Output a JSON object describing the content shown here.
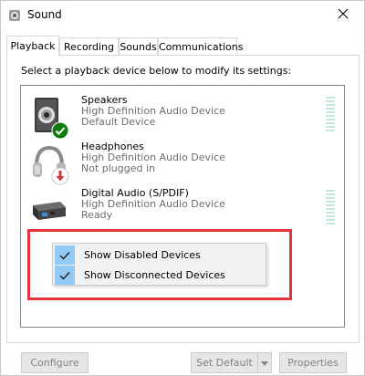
{
  "window": {
    "title": "Sound",
    "icons": {
      "app": "speaker-icon",
      "close": "close-icon"
    }
  },
  "tabs": [
    {
      "label": "Playback",
      "active": true
    },
    {
      "label": "Recording",
      "active": false
    },
    {
      "label": "Sounds",
      "active": false
    },
    {
      "label": "Communications",
      "active": false
    }
  ],
  "instruction": "Select a playback device below to modify its settings:",
  "devices": [
    {
      "name": "Speakers",
      "line1": "High Definition Audio Device",
      "line2": "Default Device",
      "icon": "speaker-icon",
      "badge": "green-check-icon",
      "meter": true
    },
    {
      "name": "Headphones",
      "line1": "High Definition Audio Device",
      "line2": "Not plugged in",
      "icon": "headphones-icon",
      "badge": "red-down-arrow-icon",
      "meter": false
    },
    {
      "name": "Digital Audio (S/PDIF)",
      "line1": "High Definition Audio Device",
      "line2": "Ready",
      "icon": "digital-audio-icon",
      "badge": "",
      "meter": true
    }
  ],
  "context_menu": {
    "items": [
      {
        "label": "Show Disabled Devices",
        "checked": true
      },
      {
        "label": "Show Disconnected Devices",
        "checked": true
      }
    ]
  },
  "buttons": {
    "configure": "Configure",
    "set_default": "Set Default",
    "properties": "Properties"
  },
  "colors": {
    "highlight": "#e2323c",
    "menu_check": "#91c9f7",
    "meter": "#c4e6de",
    "status_ok": "#107c10",
    "status_unplugged": "#d13438"
  }
}
